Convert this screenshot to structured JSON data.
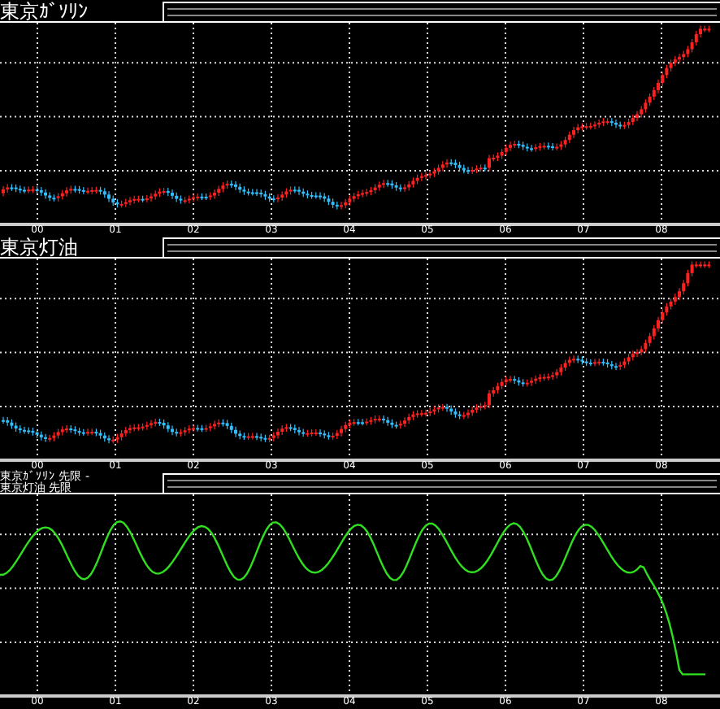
{
  "panels": [
    {
      "kind": "candle",
      "titles": [
        "東京ｶﾞｿﾘﾝ"
      ],
      "axis_labels": [
        "00",
        "01",
        "02",
        "03",
        "04",
        "05",
        "06",
        "07",
        "08"
      ]
    },
    {
      "kind": "candle",
      "titles": [
        "東京灯油"
      ],
      "axis_labels": [
        "00",
        "01",
        "02",
        "03",
        "04",
        "05",
        "06",
        "07",
        "08"
      ]
    },
    {
      "kind": "line",
      "titles": [
        "東京ｶﾞｿﾘﾝ 先限 -",
        "東京灯油 先限"
      ],
      "axis_labels": [
        "00",
        "01",
        "02",
        "03",
        "04",
        "05",
        "06",
        "07",
        "08"
      ]
    }
  ]
}
